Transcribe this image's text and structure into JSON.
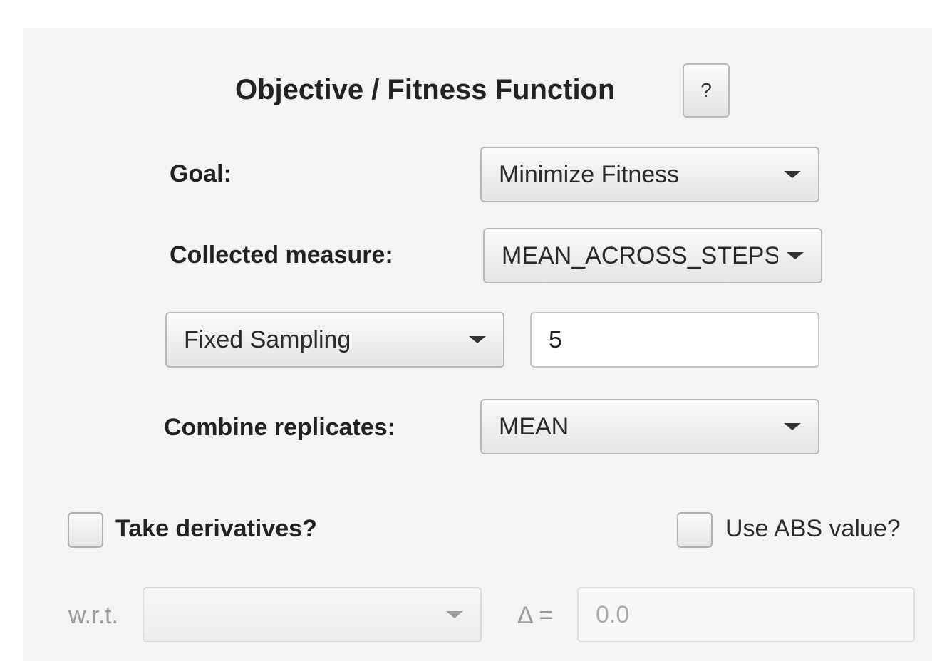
{
  "header": {
    "title": "Objective / Fitness Function",
    "help_label": "?"
  },
  "goal": {
    "label": "Goal:",
    "selected": "Minimize Fitness"
  },
  "collected_measure": {
    "label": "Collected measure:",
    "selected": "MEAN_ACROSS_STEPS"
  },
  "sampling": {
    "selected": "Fixed Sampling",
    "value": "5"
  },
  "combine_replicates": {
    "label": "Combine replicates:",
    "selected": "MEAN"
  },
  "take_derivatives": {
    "label": "Take derivatives?",
    "checked": false
  },
  "use_abs": {
    "label": "Use ABS value?",
    "checked": false
  },
  "derivative": {
    "wrt_label": "w.r.t.",
    "wrt_selected": "",
    "delta_label": "Δ =",
    "delta_placeholder": "0.0"
  }
}
